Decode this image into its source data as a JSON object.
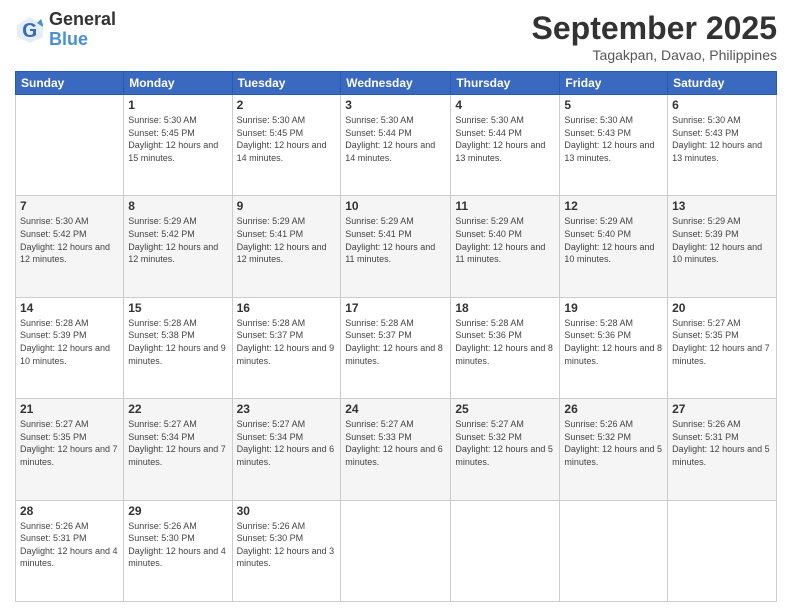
{
  "logo": {
    "general": "General",
    "blue": "Blue"
  },
  "title": "September 2025",
  "subtitle": "Tagakpan, Davao, Philippines",
  "days_header": [
    "Sunday",
    "Monday",
    "Tuesday",
    "Wednesday",
    "Thursday",
    "Friday",
    "Saturday"
  ],
  "weeks": [
    [
      {
        "day": "",
        "info": ""
      },
      {
        "day": "1",
        "info": "Sunrise: 5:30 AM\nSunset: 5:45 PM\nDaylight: 12 hours\nand 15 minutes."
      },
      {
        "day": "2",
        "info": "Sunrise: 5:30 AM\nSunset: 5:45 PM\nDaylight: 12 hours\nand 14 minutes."
      },
      {
        "day": "3",
        "info": "Sunrise: 5:30 AM\nSunset: 5:44 PM\nDaylight: 12 hours\nand 14 minutes."
      },
      {
        "day": "4",
        "info": "Sunrise: 5:30 AM\nSunset: 5:44 PM\nDaylight: 12 hours\nand 13 minutes."
      },
      {
        "day": "5",
        "info": "Sunrise: 5:30 AM\nSunset: 5:43 PM\nDaylight: 12 hours\nand 13 minutes."
      },
      {
        "day": "6",
        "info": "Sunrise: 5:30 AM\nSunset: 5:43 PM\nDaylight: 12 hours\nand 13 minutes."
      }
    ],
    [
      {
        "day": "7",
        "info": "Sunrise: 5:30 AM\nSunset: 5:42 PM\nDaylight: 12 hours\nand 12 minutes."
      },
      {
        "day": "8",
        "info": "Sunrise: 5:29 AM\nSunset: 5:42 PM\nDaylight: 12 hours\nand 12 minutes."
      },
      {
        "day": "9",
        "info": "Sunrise: 5:29 AM\nSunset: 5:41 PM\nDaylight: 12 hours\nand 12 minutes."
      },
      {
        "day": "10",
        "info": "Sunrise: 5:29 AM\nSunset: 5:41 PM\nDaylight: 12 hours\nand 11 minutes."
      },
      {
        "day": "11",
        "info": "Sunrise: 5:29 AM\nSunset: 5:40 PM\nDaylight: 12 hours\nand 11 minutes."
      },
      {
        "day": "12",
        "info": "Sunrise: 5:29 AM\nSunset: 5:40 PM\nDaylight: 12 hours\nand 10 minutes."
      },
      {
        "day": "13",
        "info": "Sunrise: 5:29 AM\nSunset: 5:39 PM\nDaylight: 12 hours\nand 10 minutes."
      }
    ],
    [
      {
        "day": "14",
        "info": "Sunrise: 5:28 AM\nSunset: 5:39 PM\nDaylight: 12 hours\nand 10 minutes."
      },
      {
        "day": "15",
        "info": "Sunrise: 5:28 AM\nSunset: 5:38 PM\nDaylight: 12 hours\nand 9 minutes."
      },
      {
        "day": "16",
        "info": "Sunrise: 5:28 AM\nSunset: 5:37 PM\nDaylight: 12 hours\nand 9 minutes."
      },
      {
        "day": "17",
        "info": "Sunrise: 5:28 AM\nSunset: 5:37 PM\nDaylight: 12 hours\nand 8 minutes."
      },
      {
        "day": "18",
        "info": "Sunrise: 5:28 AM\nSunset: 5:36 PM\nDaylight: 12 hours\nand 8 minutes."
      },
      {
        "day": "19",
        "info": "Sunrise: 5:28 AM\nSunset: 5:36 PM\nDaylight: 12 hours\nand 8 minutes."
      },
      {
        "day": "20",
        "info": "Sunrise: 5:27 AM\nSunset: 5:35 PM\nDaylight: 12 hours\nand 7 minutes."
      }
    ],
    [
      {
        "day": "21",
        "info": "Sunrise: 5:27 AM\nSunset: 5:35 PM\nDaylight: 12 hours\nand 7 minutes."
      },
      {
        "day": "22",
        "info": "Sunrise: 5:27 AM\nSunset: 5:34 PM\nDaylight: 12 hours\nand 7 minutes."
      },
      {
        "day": "23",
        "info": "Sunrise: 5:27 AM\nSunset: 5:34 PM\nDaylight: 12 hours\nand 6 minutes."
      },
      {
        "day": "24",
        "info": "Sunrise: 5:27 AM\nSunset: 5:33 PM\nDaylight: 12 hours\nand 6 minutes."
      },
      {
        "day": "25",
        "info": "Sunrise: 5:27 AM\nSunset: 5:32 PM\nDaylight: 12 hours\nand 5 minutes."
      },
      {
        "day": "26",
        "info": "Sunrise: 5:26 AM\nSunset: 5:32 PM\nDaylight: 12 hours\nand 5 minutes."
      },
      {
        "day": "27",
        "info": "Sunrise: 5:26 AM\nSunset: 5:31 PM\nDaylight: 12 hours\nand 5 minutes."
      }
    ],
    [
      {
        "day": "28",
        "info": "Sunrise: 5:26 AM\nSunset: 5:31 PM\nDaylight: 12 hours\nand 4 minutes."
      },
      {
        "day": "29",
        "info": "Sunrise: 5:26 AM\nSunset: 5:30 PM\nDaylight: 12 hours\nand 4 minutes."
      },
      {
        "day": "30",
        "info": "Sunrise: 5:26 AM\nSunset: 5:30 PM\nDaylight: 12 hours\nand 3 minutes."
      },
      {
        "day": "",
        "info": ""
      },
      {
        "day": "",
        "info": ""
      },
      {
        "day": "",
        "info": ""
      },
      {
        "day": "",
        "info": ""
      }
    ]
  ]
}
